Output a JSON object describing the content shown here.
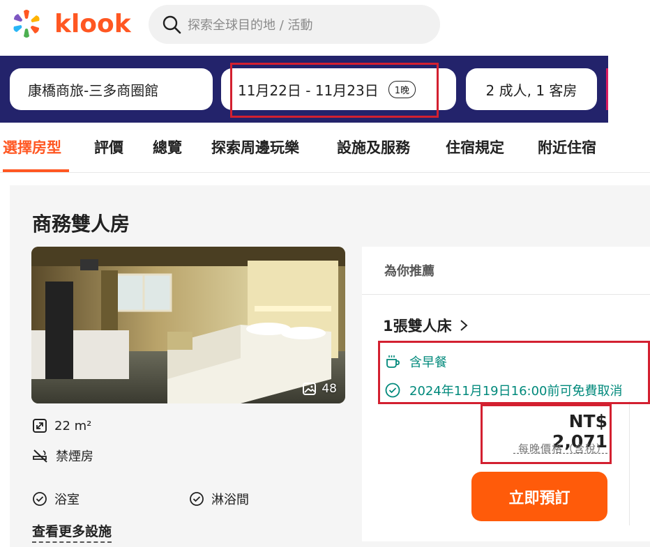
{
  "header": {
    "brand": "klook",
    "search": {
      "placeholder": "探索全球目的地 / 活動"
    }
  },
  "booking": {
    "hotel": "康橋商旅-三多商圈館",
    "dates": "11月22日 - 11月23日",
    "nights": "1晚",
    "guests": "2 成人, 1 客房"
  },
  "tabs": [
    {
      "label": "選擇房型",
      "active": true
    },
    {
      "label": "評價"
    },
    {
      "label": "總覽"
    },
    {
      "label": "探索周邊玩樂"
    },
    {
      "label": "設施及服務"
    },
    {
      "label": "住宿規定"
    },
    {
      "label": "附近住宿"
    }
  ],
  "room": {
    "title": "商務雙人房",
    "photo_count": "48",
    "size": "22 m²",
    "smoking": "禁煙房",
    "amenities": [
      "浴室",
      "淋浴間"
    ],
    "more_link": "查看更多設施"
  },
  "offer": {
    "recommend_label": "為你推薦",
    "bed_type": "1張雙人床",
    "breakfast": "含早餐",
    "cancellation": "2024年11月19日16:00前可免費取消",
    "price": "NT$ 2,071",
    "price_note": "每晚價格（含稅）",
    "book_button": "立即預訂"
  },
  "colors": {
    "brand_orange": "#ff5722",
    "booking_bar": "#23236b",
    "feature_teal": "#00897b",
    "highlight_red": "#d32030"
  }
}
